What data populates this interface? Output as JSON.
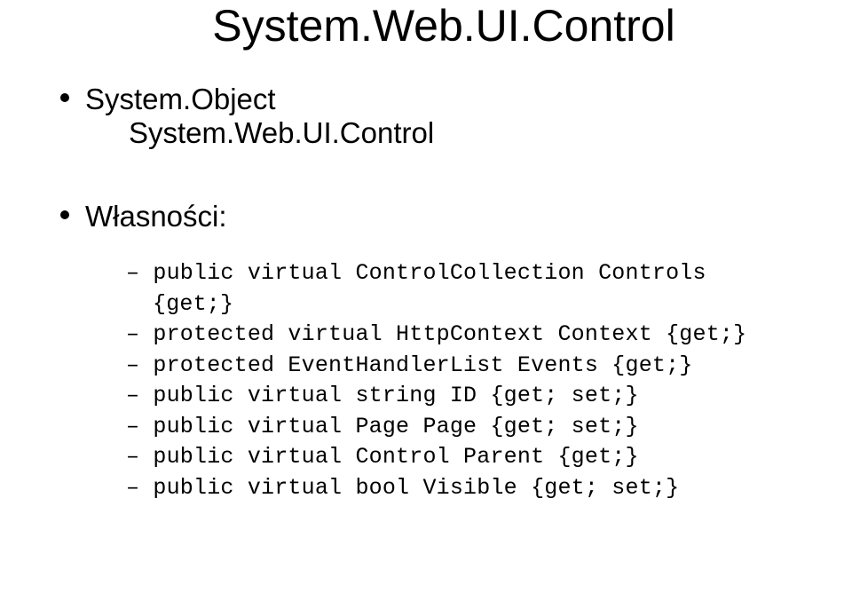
{
  "title": "System.Web.UI.Control",
  "bullet1": "System.Object",
  "indent1": "System.Web.UI.Control",
  "bullet2": "Własności:",
  "props": {
    "line1": "– public virtual ControlCollection Controls",
    "line1b": "{get;}",
    "line2": "– protected virtual HttpContext Context {get;}",
    "line3": "– protected EventHandlerList Events {get;}",
    "line4": "– public virtual string ID {get; set;}",
    "line5": "– public virtual Page Page {get; set;}",
    "line6": "– public virtual Control Parent {get;}",
    "line7": "– public virtual bool Visible {get; set;}"
  }
}
